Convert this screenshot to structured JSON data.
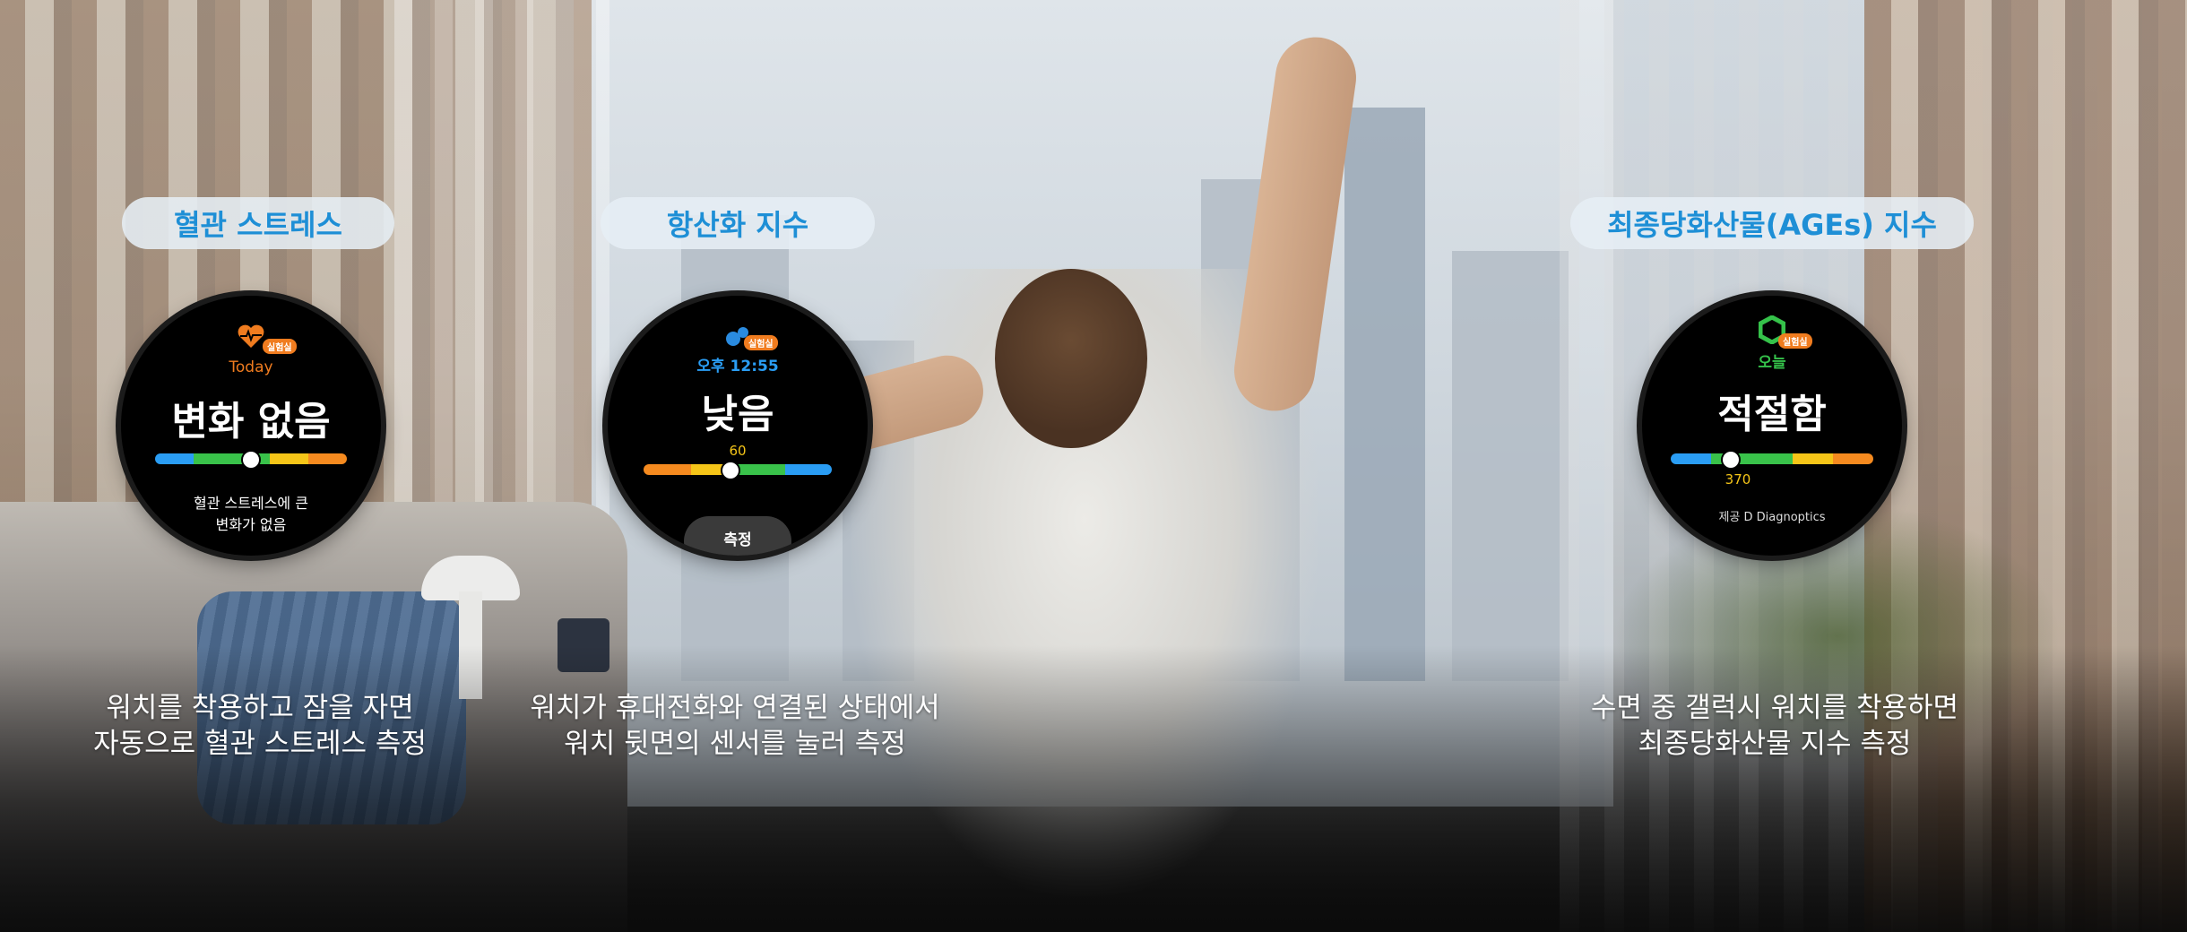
{
  "features": [
    {
      "pill_label": "혈관 스트레스",
      "watch": {
        "badge": "실험실",
        "day_label": "Today",
        "status": "변화 없음",
        "note_line1": "혈관 스트레스에 큰",
        "note_line2": "변화가 없음"
      },
      "caption_line1": "워치를 착용하고 잠을 자면",
      "caption_line2": "자동으로 혈관 스트레스 측정"
    },
    {
      "pill_label": "항산화 지수",
      "watch": {
        "badge": "실험실",
        "time_label": "오후 12:55",
        "status": "낮음",
        "value": "60",
        "button_label": "측정"
      },
      "caption_line1": "워치가 휴대전화와 연결된 상태에서",
      "caption_line2": "워치 뒷면의 센서를 눌러 측정"
    },
    {
      "pill_label": "최종당화산물(AGEs) 지수",
      "watch": {
        "badge": "실험실",
        "day_label": "오늘",
        "status": "적절함",
        "value": "370",
        "provider": "제공 D Diagnoptics"
      },
      "caption_line1": "수면 중 갤럭시 워치를 착용하면",
      "caption_line2": "최종당화산물 지수 측정"
    }
  ],
  "colors": {
    "pill_text": "#1e8fd6",
    "heart_icon": "#f07c1f",
    "antioxidant_icon": "#2a8be0",
    "ages_icon": "#35c24a",
    "badge": "#f07c1f",
    "bar_blue": "#2a9df4",
    "bar_green": "#39c24a",
    "bar_yellow": "#f5c518",
    "bar_orange": "#f58a1f"
  },
  "icons": [
    "heart-icon",
    "drop-icon",
    "hexagon-icon"
  ]
}
